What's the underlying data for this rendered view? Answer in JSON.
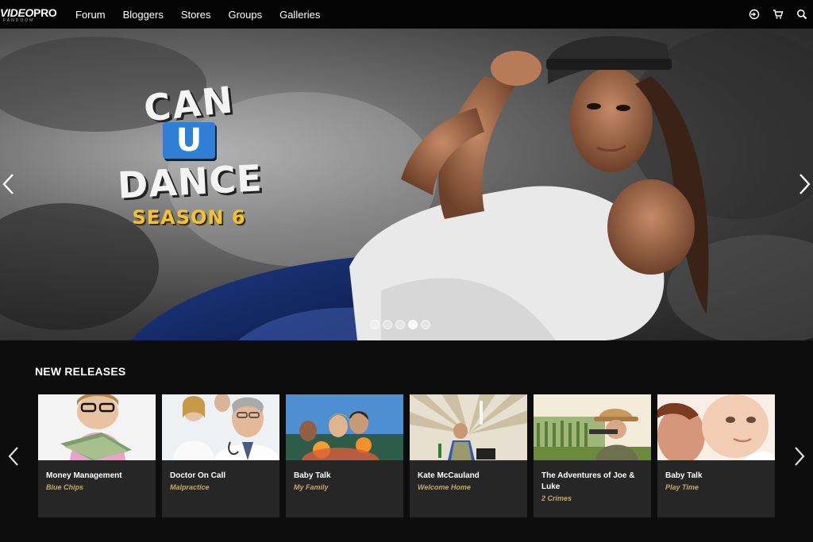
{
  "brand": {
    "name_a": "VIDEO",
    "name_b": "PRO",
    "tagline": "FANDOOM"
  },
  "nav": {
    "links": [
      "Forum",
      "Bloggers",
      "Stores",
      "Groups",
      "Galleries"
    ],
    "icons": [
      "sign-in-icon",
      "cart-icon",
      "search-icon"
    ]
  },
  "hero": {
    "title_line1": "CAN",
    "title_line2": "U",
    "title_line3": "DANCE",
    "subtitle": "SEASON 6",
    "slide_count": 5,
    "active_slide": 4
  },
  "releases": {
    "heading": "NEW RELEASES",
    "items": [
      {
        "title": "Money Management",
        "subtitle": "Blue Chips"
      },
      {
        "title": "Doctor On Call",
        "subtitle": "Malpractice"
      },
      {
        "title": "Baby Talk",
        "subtitle": "My Family"
      },
      {
        "title": "Kate McCauland",
        "subtitle": "Welcome Home"
      },
      {
        "title": "The Adventures of Joe & Luke",
        "subtitle": "2 Crimes"
      },
      {
        "title": "Baby Talk",
        "subtitle": "Play Time"
      }
    ]
  },
  "colors": {
    "accent_blue": "#2f7fd6",
    "season_yellow": "#f1c232",
    "subtitle_gold": "#c8a86a",
    "card_bg": "#262626"
  }
}
